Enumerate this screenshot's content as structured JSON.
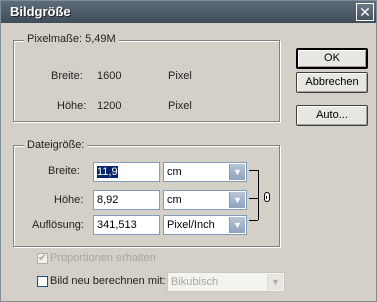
{
  "window": {
    "title": "Bildgröße"
  },
  "buttons": {
    "ok": "OK",
    "cancel": "Abbrechen",
    "auto": "Auto..."
  },
  "pixel_dimensions": {
    "legend": "Pixelmaße: 5,49M",
    "width_label": "Breite:",
    "width_value": "1600",
    "width_unit": "Pixel",
    "height_label": "Höhe:",
    "height_value": "1200",
    "height_unit": "Pixel"
  },
  "document_size": {
    "legend": "Dateigröße:",
    "width_label": "Breite:",
    "width_value": "11,9",
    "width_unit": "cm",
    "height_label": "Höhe:",
    "height_value": "8,92",
    "height_unit": "cm",
    "resolution_label": "Auflösung:",
    "resolution_value": "341,513",
    "resolution_unit": "Pixel/Inch"
  },
  "options": {
    "constrain_label": "Proportionen erhalten",
    "constrain_checked": true,
    "constrain_enabled": false,
    "resample_label": "Bild neu berechnen mit:",
    "resample_checked": false,
    "resample_method": "Bikubisch"
  },
  "icons": {
    "close": "close-icon",
    "link": "chain-link-icon",
    "dropdown": "chevron-down-icon"
  }
}
